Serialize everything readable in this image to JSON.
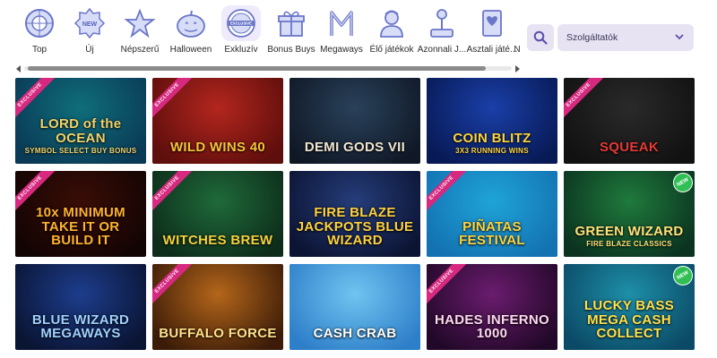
{
  "categories": [
    {
      "label": "Top",
      "icon": "roulette-icon"
    },
    {
      "label": "Új",
      "icon": "new-badge-icon"
    },
    {
      "label": "Népszerű",
      "icon": "star-icon"
    },
    {
      "label": "Halloween",
      "icon": "pumpkin-icon"
    },
    {
      "label": "Exkluzív",
      "icon": "exclusive-icon",
      "badge": "EXCLUSIVE"
    },
    {
      "label": "Bonus Buys",
      "icon": "gift-icon"
    },
    {
      "label": "Megaways",
      "icon": "megaways-icon"
    },
    {
      "label": "Élő játékok",
      "icon": "live-dealer-icon"
    },
    {
      "label": "Azonnali J...",
      "icon": "joystick-icon"
    },
    {
      "label": "Asztali játé...",
      "icon": "cards-icon"
    },
    {
      "label": "N",
      "icon": "more-icon"
    }
  ],
  "search": {
    "icon": "search-icon"
  },
  "provider_filter": {
    "label": "Szolgáltatók"
  },
  "exclusive_label": "EXCLUSIVE",
  "new_label": "NEW",
  "games": [
    {
      "title": "LORD of the OCEAN",
      "sub": "SYMBOL SELECT BUY BONUS",
      "exclusive": true,
      "new": false,
      "bg": "#0f6e7a",
      "bg2": "#0a3a55",
      "fg": "#f1d36a"
    },
    {
      "title": "WILD WINS 40",
      "sub": "",
      "exclusive": true,
      "new": false,
      "bg": "#b3261e",
      "bg2": "#5e0e0c",
      "fg": "#f5c33a"
    },
    {
      "title": "DEMI GODS VII",
      "sub": "",
      "exclusive": false,
      "new": false,
      "bg": "#29415a",
      "bg2": "#101826",
      "fg": "#f0e6d0"
    },
    {
      "title": "COIN BLITZ",
      "sub": "3X3 RUNNING WINS",
      "exclusive": false,
      "new": false,
      "bg": "#1a3fa8",
      "bg2": "#081a55",
      "fg": "#ffd43b"
    },
    {
      "title": "SQUEAK",
      "sub": "",
      "exclusive": true,
      "new": false,
      "bg": "#2a2a2a",
      "bg2": "#111111",
      "fg": "#e53935"
    },
    {
      "title": "10x MINIMUM TAKE IT OR BUILD IT",
      "sub": "",
      "exclusive": true,
      "new": false,
      "bg": "#3a0d06",
      "bg2": "#120403",
      "fg": "#ffb32e"
    },
    {
      "title": "WITCHES BREW",
      "sub": "",
      "exclusive": true,
      "new": false,
      "bg": "#1f6a3a",
      "bg2": "#0d2c1a",
      "fg": "#f4d23a"
    },
    {
      "title": "FIRE BLAZE JACKPOTS BLUE WIZARD",
      "sub": "",
      "exclusive": false,
      "new": false,
      "bg": "#253d7a",
      "bg2": "#0c1433",
      "fg": "#ffd23f"
    },
    {
      "title": "PIÑATAS FESTIVAL",
      "sub": "",
      "exclusive": true,
      "new": false,
      "bg": "#1fa4d8",
      "bg2": "#1372b2",
      "fg": "#ffd43b"
    },
    {
      "title": "GREEN WIZARD",
      "sub": "FIRE BLAZE CLASSICS",
      "exclusive": false,
      "new": true,
      "bg": "#1f7a3c",
      "bg2": "#0b3320",
      "fg": "#ffe27a"
    },
    {
      "title": "BLUE WIZARD MEGAWAYS",
      "sub": "",
      "exclusive": false,
      "new": false,
      "bg": "#1d3d8c",
      "bg2": "#0a1433",
      "fg": "#9fd0ff"
    },
    {
      "title": "BUFFALO FORCE",
      "sub": "",
      "exclusive": true,
      "new": false,
      "bg": "#b4661a",
      "bg2": "#3c1c08",
      "fg": "#ffe08a"
    },
    {
      "title": "CASH CRAB",
      "sub": "",
      "exclusive": false,
      "new": false,
      "bg": "#6fc4f0",
      "bg2": "#2e7fc9",
      "fg": "#ffffff"
    },
    {
      "title": "HADES INFERNO 1000",
      "sub": "",
      "exclusive": true,
      "new": false,
      "bg": "#6a1c6e",
      "bg2": "#220828",
      "fg": "#ffd8f0"
    },
    {
      "title": "LUCKY BASS MEGA CASH COLLECT",
      "sub": "",
      "exclusive": false,
      "new": true,
      "bg": "#1e8fa8",
      "bg2": "#0b4a66",
      "fg": "#ffe14a"
    }
  ]
}
